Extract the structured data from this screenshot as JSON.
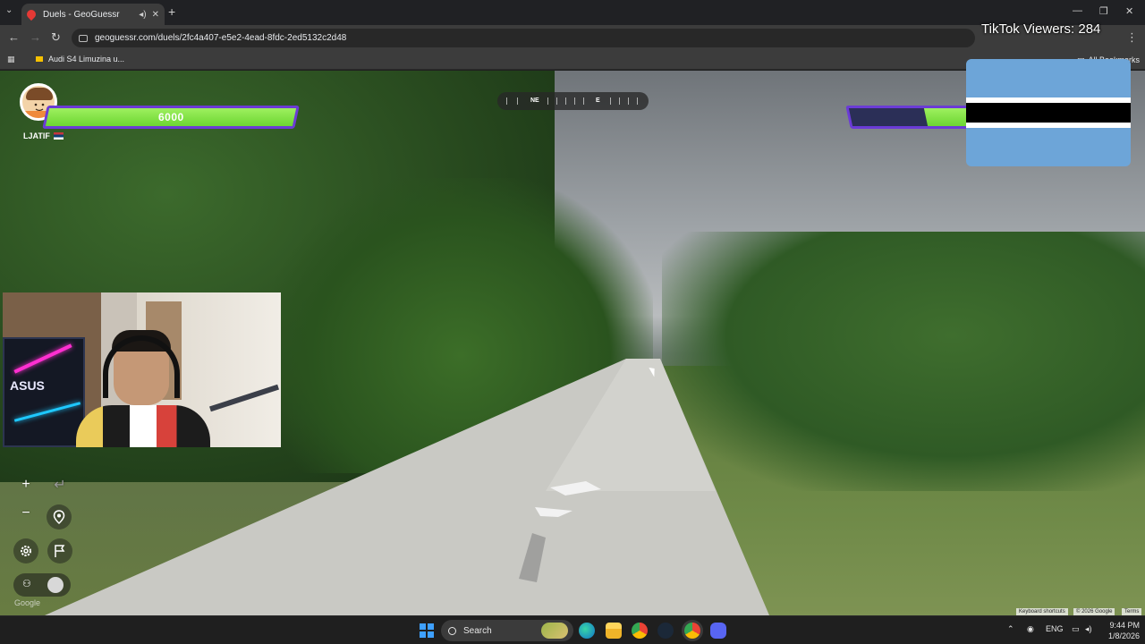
{
  "browser": {
    "tab_title": "Duels - GeoGuessr",
    "url": "geoguessr.com/duels/2fc4a407-e5e2-4ead-8fdc-2ed5132c2d48",
    "bookmark_item": "Audi S4 Limuzina u...",
    "all_bookmarks": "All Bookmarks"
  },
  "hud": {
    "player_health": "6000",
    "player_name": "LJATIF",
    "compass_labels": [
      "NE",
      "E"
    ],
    "opponent_health_fraction": 0.42,
    "accent": "#6b3bd6",
    "health_color": "#7fe33f"
  },
  "overlay": {
    "viewers_text": "TikTok Viewers: 284",
    "flag_country": "Botswana"
  },
  "map": {
    "google": "Google",
    "keyboard_shortcuts": "Keyboard shortcuts",
    "copyright": "© 2026 Google",
    "terms": "Terms"
  },
  "controls": {
    "zoom_in": "+",
    "zoom_out": "−",
    "undo_icon": "undo-icon",
    "pin_icon": "location-pin-icon",
    "settings_icon": "gear-icon",
    "flag_icon": "flag-icon"
  },
  "taskbar": {
    "search_label": "Search",
    "lang": "ENG",
    "time": "9:44 PM",
    "date": "1/8/2026"
  }
}
